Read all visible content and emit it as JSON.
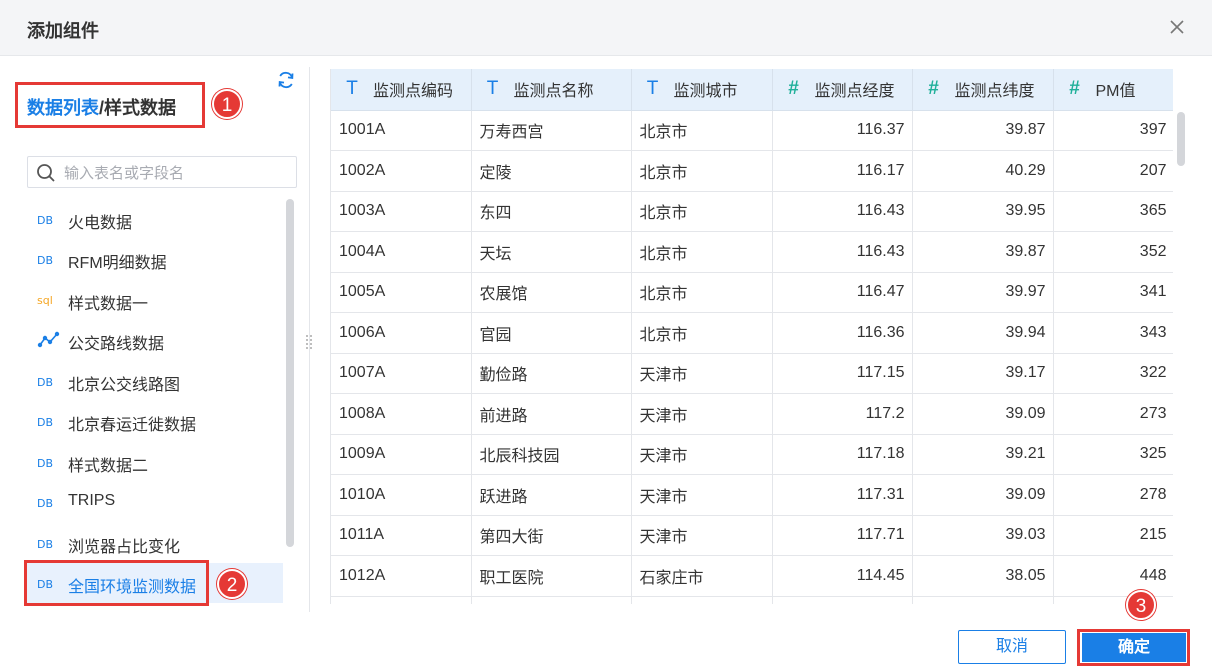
{
  "dialog": {
    "title": "添加组件"
  },
  "breadcrumb": {
    "link": "数据列表",
    "separator": "/",
    "current": "样式数据"
  },
  "badges": {
    "b1": "1",
    "b2": "2",
    "b3": "3"
  },
  "search": {
    "placeholder": "输入表名或字段名"
  },
  "sources": [
    {
      "label": "火电数据",
      "icon": "db-icon"
    },
    {
      "label": "RFM明细数据",
      "icon": "db-icon"
    },
    {
      "label": "样式数据一",
      "icon": "sql-icon"
    },
    {
      "label": "公交路线数据",
      "icon": "graph-icon"
    },
    {
      "label": "北京公交线路图",
      "icon": "db-icon"
    },
    {
      "label": "北京春运迁徙数据",
      "icon": "db-icon"
    },
    {
      "label": "样式数据二",
      "icon": "db-icon"
    },
    {
      "label": "TRIPS",
      "icon": "db-icon"
    },
    {
      "label": "浏览器占比变化",
      "icon": "db-icon"
    },
    {
      "label": "全国环境监测数据",
      "icon": "db-icon",
      "selected": true
    }
  ],
  "icons": {
    "db": "DB",
    "sql": "sql",
    "type_text": "T",
    "type_num": "#"
  },
  "table": {
    "columns": [
      {
        "type": "text",
        "label": "监测点编码"
      },
      {
        "type": "text",
        "label": "监测点名称"
      },
      {
        "type": "text",
        "label": "监测城市"
      },
      {
        "type": "number",
        "label": "监测点经度"
      },
      {
        "type": "number",
        "label": "监测点纬度"
      },
      {
        "type": "number",
        "label": "PM值"
      }
    ],
    "rows": [
      [
        "1001A",
        "万寿西宫",
        "北京市",
        "116.37",
        "39.87",
        "397"
      ],
      [
        "1002A",
        "定陵",
        "北京市",
        "116.17",
        "40.29",
        "207"
      ],
      [
        "1003A",
        "东四",
        "北京市",
        "116.43",
        "39.95",
        "365"
      ],
      [
        "1004A",
        "天坛",
        "北京市",
        "116.43",
        "39.87",
        "352"
      ],
      [
        "1005A",
        "农展馆",
        "北京市",
        "116.47",
        "39.97",
        "341"
      ],
      [
        "1006A",
        "官园",
        "北京市",
        "116.36",
        "39.94",
        "343"
      ],
      [
        "1007A",
        "勤俭路",
        "天津市",
        "117.15",
        "39.17",
        "322"
      ],
      [
        "1008A",
        "前进路",
        "天津市",
        "117.2",
        "39.09",
        "273"
      ],
      [
        "1009A",
        "北辰科技园",
        "天津市",
        "117.18",
        "39.21",
        "325"
      ],
      [
        "1010A",
        "跃进路",
        "天津市",
        "117.31",
        "39.09",
        "278"
      ],
      [
        "1011A",
        "第四大街",
        "天津市",
        "117.71",
        "39.03",
        "215"
      ],
      [
        "1012A",
        "职工医院",
        "石家庄市",
        "114.45",
        "38.05",
        "448"
      ],
      [
        "",
        "",
        "",
        "",
        "",
        ""
      ]
    ]
  },
  "footer": {
    "cancel": "取消",
    "ok": "确定"
  },
  "colors": {
    "accent": "#1a7fe6",
    "annotation": "#e53935",
    "number_type": "#20b09a",
    "header_bg": "#e5f0fb"
  }
}
